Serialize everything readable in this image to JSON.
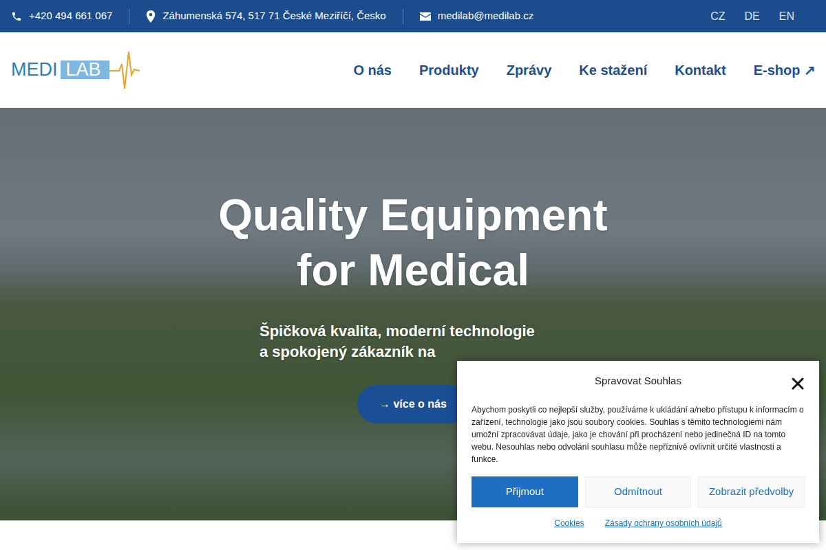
{
  "topbar": {
    "phone": "+420 494 661 067",
    "address": "Záhumenská 574, 517 71 České Meziříčí, Česko",
    "email": "medilab@medilab.cz",
    "languages": [
      "CZ",
      "DE",
      "EN"
    ]
  },
  "logo": {
    "left": "MEDI",
    "right": "LAB"
  },
  "nav": [
    "O nás",
    "Produkty",
    "Zprávy",
    "Ke stažení",
    "Kontakt",
    "E-shop ↗"
  ],
  "hero": {
    "title_lines": [
      "Quality Equipment",
      "for Medical"
    ],
    "subtitle_lines": [
      "Špičková kvalita, moderní technologie",
      "a spokojený zákazník na"
    ],
    "button": "→ více o nás"
  },
  "consent": {
    "title": "Spravovat Souhlas",
    "text": "Abychom poskytli co nejlepší služby, používáme k ukládání a/nebo přístupu k informacím o zařízení, technologie jako jsou soubory cookies. Souhlas s těmito technologiemi nám umožní zpracovávat údaje, jako je chování při procházení nebo jedinečná ID na tomto webu. Nesouhlas nebo odvolání souhlasu může nepříznivě ovlivnit určité vlastnosti a funkce.",
    "buttons": [
      {
        "label": "Přijmout",
        "kind": "primary"
      },
      {
        "label": "Odmítnout",
        "kind": "secondary"
      },
      {
        "label": "Zobrazit předvolby",
        "kind": "secondary"
      }
    ],
    "links": [
      "Cookies",
      "Zásady ochrany osobních údajů"
    ]
  }
}
